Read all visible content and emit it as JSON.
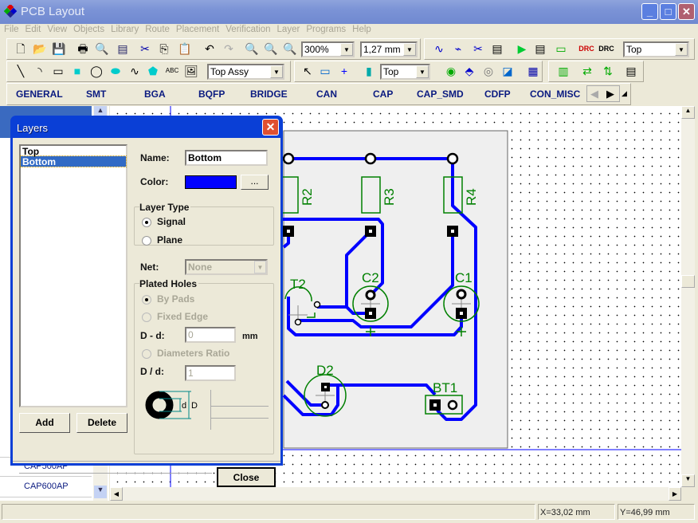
{
  "window": {
    "title": "PCB Layout"
  },
  "menu": [
    "File",
    "Edit",
    "View",
    "Objects",
    "Library",
    "Route",
    "Placement",
    "Verification",
    "Layer",
    "Programs",
    "Help"
  ],
  "toolbar": {
    "zoom": "300%",
    "grid": "1,27 mm",
    "layer": "Top",
    "assy_layer": "Top Assy",
    "place_layer": "Top"
  },
  "library_tabs": [
    "GENERAL",
    "SMT",
    "BGA",
    "BQFP",
    "BRIDGE",
    "CAN",
    "CAP",
    "CAP_SMD",
    "CDFP",
    "CON_MISC"
  ],
  "component_list": [
    "CAP500AP",
    "CAP600AP"
  ],
  "pcb": {
    "labels": [
      "R2",
      "R3",
      "R4",
      "T2",
      "C2",
      "C1",
      "D2",
      "BT1"
    ],
    "trace_color": "#0000ff",
    "silk_color": "#008000"
  },
  "status": {
    "x": "X=33,02 mm",
    "y": "Y=46,99 mm"
  },
  "dialog": {
    "title": "Layers",
    "layers": [
      "Top",
      "Bottom"
    ],
    "selected_layer": "Bottom",
    "name_label": "Name:",
    "name_value": "Bottom",
    "color_label": "Color:",
    "color_value": "#0000ff",
    "color_button": "...",
    "layer_type_label": "Layer Type",
    "signal": "Signal",
    "plane": "Plane",
    "net_label": "Net:",
    "net_value": "None",
    "plated_holes_label": "Plated Holes",
    "by_pads": "By Pads",
    "fixed_edge": "Fixed Edge",
    "dd_minus_label": "D - d:",
    "dd_minus_value": "0",
    "mm": "mm",
    "diam_ratio": "Diameters Ratio",
    "dd_ratio_label": "D / d:",
    "dd_ratio_value": "1",
    "diagram_d": "d",
    "diagram_D": "D",
    "add": "Add",
    "delete": "Delete",
    "close": "Close"
  }
}
